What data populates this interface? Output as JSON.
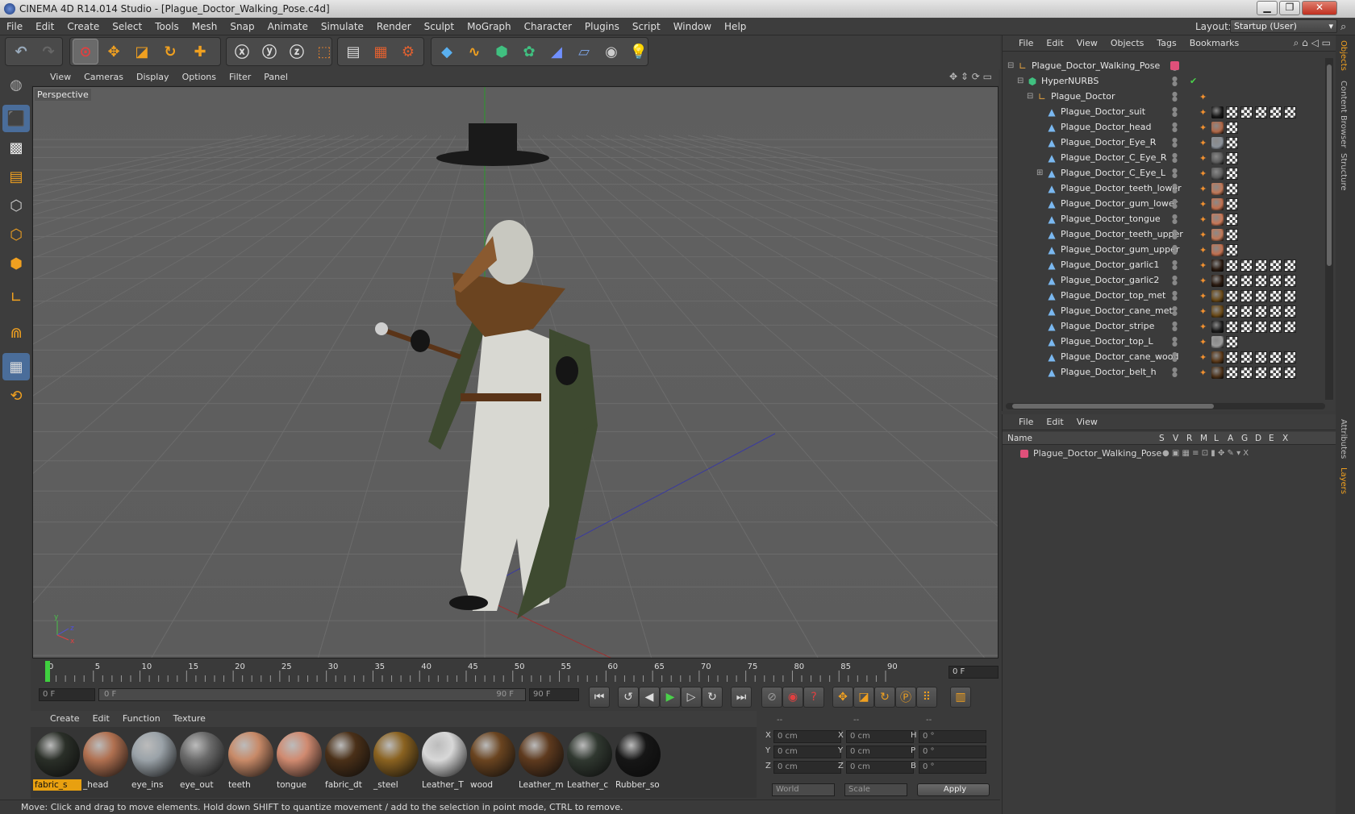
{
  "window": {
    "title": "CINEMA 4D R14.014 Studio - [Plague_Doctor_Walking_Pose.c4d]",
    "minimize": "▁",
    "restore": "❐",
    "close": "✕"
  },
  "menu": [
    "File",
    "Edit",
    "Create",
    "Select",
    "Tools",
    "Mesh",
    "Snap",
    "Animate",
    "Simulate",
    "Render",
    "Sculpt",
    "MoGraph",
    "Character",
    "Plugins",
    "Script",
    "Window",
    "Help"
  ],
  "layout": {
    "label": "Layout:",
    "value": "Startup (User)"
  },
  "viewport": {
    "menu": [
      "View",
      "Cameras",
      "Display",
      "Options",
      "Filter",
      "Panel"
    ],
    "camera_label": "Perspective",
    "axis_labels": {
      "y": "y",
      "z": "z",
      "x": "x"
    }
  },
  "timeline": {
    "ticks": [
      "0",
      "5",
      "10",
      "15",
      "20",
      "25",
      "30",
      "35",
      "40",
      "45",
      "50",
      "55",
      "60",
      "65",
      "70",
      "75",
      "80",
      "85",
      "90"
    ],
    "current_frame_field": "0 F",
    "start_field": "0 F",
    "range_start": "0 F",
    "range_end": "90 F",
    "end_field": "90 F"
  },
  "material_manager": {
    "menu": [
      "Create",
      "Edit",
      "Function",
      "Texture"
    ],
    "materials": [
      {
        "name": "fabric_s",
        "selected": true,
        "color": "#2a2f28"
      },
      {
        "name": "_head",
        "selected": false,
        "color": "#b07050"
      },
      {
        "name": "eye_ins",
        "selected": false,
        "color": "#9aa2a8"
      },
      {
        "name": "eye_out",
        "selected": false,
        "color": "#6a6a6a"
      },
      {
        "name": "teeth",
        "selected": false,
        "color": "#c88a68"
      },
      {
        "name": "tongue",
        "selected": false,
        "color": "#d08a70"
      },
      {
        "name": "fabric_dt",
        "selected": false,
        "color": "#4a3018"
      },
      {
        "name": "_steel",
        "selected": false,
        "color": "#8a6220"
      },
      {
        "name": "Leather_T",
        "selected": false,
        "color": "#d8d8d8"
      },
      {
        "name": "wood",
        "selected": false,
        "color": "#6a4420"
      },
      {
        "name": "Leather_m",
        "selected": false,
        "color": "#5e3a1e"
      },
      {
        "name": "Leather_c",
        "selected": false,
        "color": "#303830"
      },
      {
        "name": "Rubber_so",
        "selected": false,
        "color": "#161616"
      }
    ]
  },
  "coords": {
    "header": [
      "--",
      "--",
      "--"
    ],
    "rows": [
      {
        "a": "X",
        "av": "0 cm",
        "b": "X",
        "bv": "0 cm",
        "c": "H",
        "cv": "0 °"
      },
      {
        "a": "Y",
        "av": "0 cm",
        "b": "Y",
        "bv": "0 cm",
        "c": "P",
        "cv": "0 °"
      },
      {
        "a": "Z",
        "av": "0 cm",
        "b": "Z",
        "bv": "0 cm",
        "c": "B",
        "cv": "0 °"
      }
    ],
    "world": "World",
    "scale": "Scale",
    "apply": "Apply"
  },
  "status": "Move: Click and drag to move elements. Hold down SHIFT to quantize movement / add to the selection in point mode, CTRL to remove.",
  "object_manager": {
    "menu": [
      "File",
      "Edit",
      "View",
      "Objects",
      "Tags",
      "Bookmarks"
    ],
    "objects": [
      {
        "name": "Plague_Doctor_Walking_Pose",
        "level": 0,
        "icon": "null",
        "tags": []
      },
      {
        "name": "HyperNURBS",
        "level": 1,
        "icon": "nurbs",
        "tags": []
      },
      {
        "name": "Plague_Doctor",
        "level": 2,
        "icon": "null",
        "tags": [
          "phong"
        ]
      },
      {
        "name": "Plague_Doctor_suit",
        "level": 3,
        "icon": "poly",
        "tags": [
          "phong",
          "#1a1a1a",
          "checker",
          "checker",
          "checker",
          "checker",
          "checker"
        ]
      },
      {
        "name": "Plague_Doctor_head",
        "level": 3,
        "icon": "poly",
        "tags": [
          "phong",
          "#b06848",
          "checker"
        ]
      },
      {
        "name": "Plague_Doctor_Eye_R",
        "level": 3,
        "icon": "poly",
        "tags": [
          "phong",
          "#8a9098",
          "checker"
        ]
      },
      {
        "name": "Plague_Doctor_C_Eye_R",
        "level": 3,
        "icon": "poly",
        "tags": [
          "phong",
          "#5a5a5a",
          "checker"
        ]
      },
      {
        "name": "Plague_Doctor_C_Eye_L",
        "level": 3,
        "icon": "poly",
        "tags": [
          "phong",
          "#5a5a5a",
          "checker"
        ]
      },
      {
        "name": "Plague_Doctor_teeth_lower",
        "level": 3,
        "icon": "poly",
        "tags": [
          "phong",
          "#c07858",
          "checker"
        ]
      },
      {
        "name": "Plague_Doctor_gum_lower",
        "level": 3,
        "icon": "poly",
        "tags": [
          "phong",
          "#c07050",
          "checker"
        ]
      },
      {
        "name": "Plague_Doctor_tongue",
        "level": 3,
        "icon": "poly",
        "tags": [
          "phong",
          "#c87858",
          "checker"
        ]
      },
      {
        "name": "Plague_Doctor_teeth_upper",
        "level": 3,
        "icon": "poly",
        "tags": [
          "phong",
          "#c07858",
          "checker"
        ]
      },
      {
        "name": "Plague_Doctor_gum_upper",
        "level": 3,
        "icon": "poly",
        "tags": [
          "phong",
          "#c07050",
          "checker"
        ]
      },
      {
        "name": "Plague_Doctor_garlic1",
        "level": 3,
        "icon": "poly",
        "tags": [
          "phong",
          "#2a1a10",
          "checker",
          "checker",
          "checker",
          "checker",
          "checker"
        ]
      },
      {
        "name": "Plague_Doctor_garlic2",
        "level": 3,
        "icon": "poly",
        "tags": [
          "phong",
          "#2a1a10",
          "checker",
          "checker",
          "checker",
          "checker",
          "checker"
        ]
      },
      {
        "name": "Plague_Doctor_top_met",
        "level": 3,
        "icon": "poly",
        "tags": [
          "phong",
          "#6a4a18",
          "checker",
          "checker",
          "checker",
          "checker",
          "checker"
        ]
      },
      {
        "name": "Plague_Doctor_cane_met",
        "level": 3,
        "icon": "poly",
        "tags": [
          "phong",
          "#6a4a18",
          "checker",
          "checker",
          "checker",
          "checker",
          "checker"
        ]
      },
      {
        "name": "Plague_Doctor_stripe",
        "level": 3,
        "icon": "poly",
        "tags": [
          "phong",
          "#1e1e1e",
          "checker",
          "checker",
          "checker",
          "checker",
          "checker"
        ]
      },
      {
        "name": "Plague_Doctor_top_L",
        "level": 3,
        "icon": "poly",
        "tags": [
          "phong",
          "#9a9a9a",
          "checker"
        ]
      },
      {
        "name": "Plague_Doctor_cane_wood",
        "level": 3,
        "icon": "poly",
        "tags": [
          "phong",
          "#5a3818",
          "checker",
          "checker",
          "checker",
          "checker",
          "checker"
        ]
      },
      {
        "name": "Plague_Doctor_belt_h",
        "level": 3,
        "icon": "poly",
        "tags": [
          "phong",
          "#4a3018",
          "checker",
          "checker",
          "checker",
          "checker",
          "checker"
        ]
      }
    ]
  },
  "layer_manager": {
    "menu": [
      "File",
      "Edit",
      "View"
    ],
    "columns": [
      "Name",
      "S",
      "V",
      "R",
      "M",
      "L",
      "A",
      "G",
      "D",
      "E",
      "X"
    ],
    "layer": {
      "name": "Plague_Doctor_Walking_Pose",
      "color": "#e0507a"
    }
  },
  "right_tabs": [
    "Objects",
    "Content Browser",
    "Structure",
    "Attributes",
    "Layers"
  ]
}
